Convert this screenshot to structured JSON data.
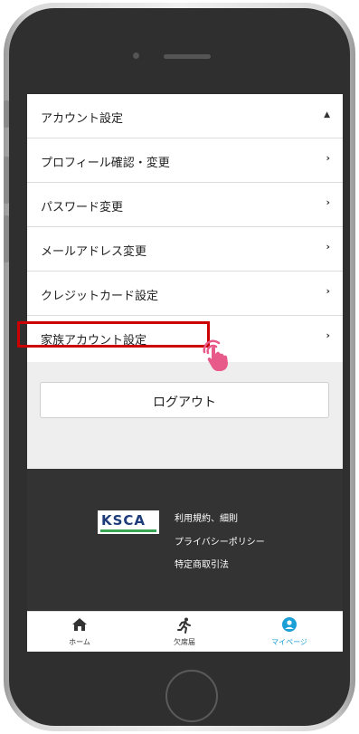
{
  "account_header": {
    "label": "アカウント設定",
    "chevron": "▲"
  },
  "menu_items": [
    {
      "label": "プロフィール確認・変更",
      "chevron": "›"
    },
    {
      "label": "パスワード変更",
      "chevron": "›"
    },
    {
      "label": "メールアドレス変更",
      "chevron": "›"
    },
    {
      "label": "クレジットカード設定",
      "chevron": "›"
    },
    {
      "label": "家族アカウント設定",
      "chevron": "›"
    }
  ],
  "logout_label": "ログアウト",
  "footer": {
    "logo_text": "KSCA",
    "links": [
      "利用規約、細則",
      "プライバシーポリシー",
      "特定商取引法"
    ]
  },
  "tabs": [
    {
      "label": "ホーム",
      "icon": "home-icon",
      "active": false
    },
    {
      "label": "欠席届",
      "icon": "running-person-icon",
      "active": false
    },
    {
      "label": "マイページ",
      "icon": "user-circle-icon",
      "active": true
    }
  ],
  "colors": {
    "accent": "#1a9fd6",
    "highlight": "#cc0000",
    "tap_icon": "#e85a8a",
    "footer_bg": "#333333"
  }
}
